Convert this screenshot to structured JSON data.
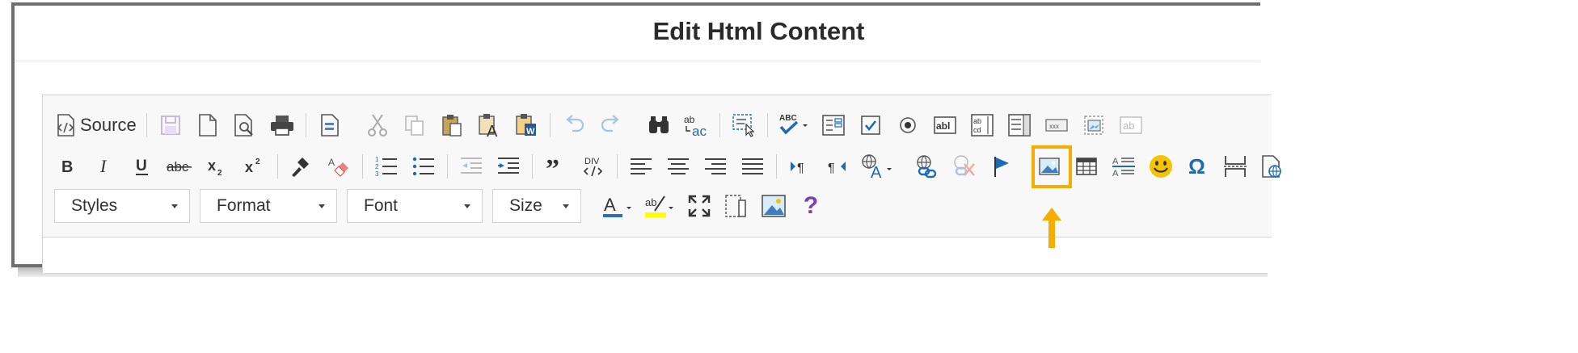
{
  "dialog": {
    "title": "Edit Html Content"
  },
  "toolbar": {
    "source_label": "Source",
    "combos": {
      "styles": "Styles",
      "format": "Format",
      "font": "Font",
      "size": "Size"
    },
    "help_label": "?"
  },
  "colors": {
    "highlight": "#f5ad00",
    "text_color_bar": "#2b6fb6",
    "bg_color_bar": "#ffff00",
    "smiley": "#f5c400",
    "omega": "#1e6ab4",
    "flag": "#1e6ab4",
    "help": "#7a3fb5"
  },
  "icons": [
    "source-icon",
    "save-icon",
    "new-page-icon",
    "preview-icon",
    "print-icon",
    "templates-icon",
    "cut-icon",
    "copy-icon",
    "paste-icon",
    "paste-text-icon",
    "paste-word-icon",
    "undo-icon",
    "redo-icon",
    "find-icon",
    "replace-icon",
    "select-all-icon",
    "spellcheck-icon",
    "form-icon",
    "checkbox-icon",
    "radio-icon",
    "textfield-icon",
    "textarea-icon",
    "select-icon",
    "button-icon",
    "imagebutton-icon",
    "hiddenfield-icon",
    "bold-icon",
    "italic-icon",
    "underline-icon",
    "strike-icon",
    "subscript-icon",
    "superscript-icon",
    "copy-format-icon",
    "remove-format-icon",
    "numbered-list-icon",
    "bulleted-list-icon",
    "outdent-icon",
    "indent-icon",
    "blockquote-icon",
    "div-icon",
    "align-left-icon",
    "align-center-icon",
    "align-right-icon",
    "justify-icon",
    "ltr-icon",
    "rtl-icon",
    "language-icon",
    "link-icon",
    "unlink-icon",
    "anchor-icon",
    "image-icon",
    "table-icon",
    "horizontal-rule-icon",
    "smiley-icon",
    "special-char-icon",
    "page-break-icon",
    "iframe-icon",
    "text-color-icon",
    "bg-color-icon",
    "maximize-icon",
    "show-blocks-icon",
    "about-image-icon",
    "help-icon"
  ]
}
